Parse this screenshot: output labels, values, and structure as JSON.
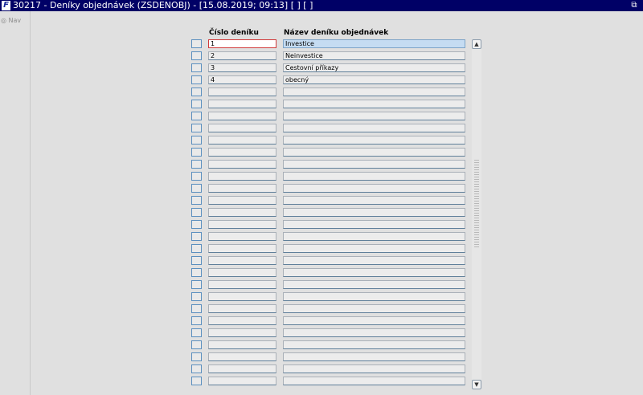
{
  "window": {
    "title": "30217 - Deníky objednávek (ZSDENOBJ) - [15.08.2019; 09:13]  [ ]  [ ]",
    "logo_text": "F",
    "restore_icon": "restore-icon"
  },
  "nav": {
    "label": "Nav",
    "icon": "nav-icon"
  },
  "columns": {
    "number": "Číslo deníku",
    "name": "Název deníku objednávek"
  },
  "rows": [
    {
      "number": "1",
      "name": "Investice"
    },
    {
      "number": "2",
      "name": "Neinvestice"
    },
    {
      "number": "3",
      "name": "Cestovní příkazy"
    },
    {
      "number": "4",
      "name": "obecný"
    },
    {
      "number": "",
      "name": ""
    },
    {
      "number": "",
      "name": ""
    },
    {
      "number": "",
      "name": ""
    },
    {
      "number": "",
      "name": ""
    },
    {
      "number": "",
      "name": ""
    },
    {
      "number": "",
      "name": ""
    },
    {
      "number": "",
      "name": ""
    },
    {
      "number": "",
      "name": ""
    },
    {
      "number": "",
      "name": ""
    },
    {
      "number": "",
      "name": ""
    },
    {
      "number": "",
      "name": ""
    },
    {
      "number": "",
      "name": ""
    },
    {
      "number": "",
      "name": ""
    },
    {
      "number": "",
      "name": ""
    },
    {
      "number": "",
      "name": ""
    },
    {
      "number": "",
      "name": ""
    },
    {
      "number": "",
      "name": ""
    },
    {
      "number": "",
      "name": ""
    },
    {
      "number": "",
      "name": ""
    },
    {
      "number": "",
      "name": ""
    },
    {
      "number": "",
      "name": ""
    },
    {
      "number": "",
      "name": ""
    },
    {
      "number": "",
      "name": ""
    },
    {
      "number": "",
      "name": ""
    },
    {
      "number": "",
      "name": ""
    }
  ],
  "scrollbar": {
    "up_icon": "arrow-up-icon",
    "down_icon": "arrow-down-icon"
  }
}
